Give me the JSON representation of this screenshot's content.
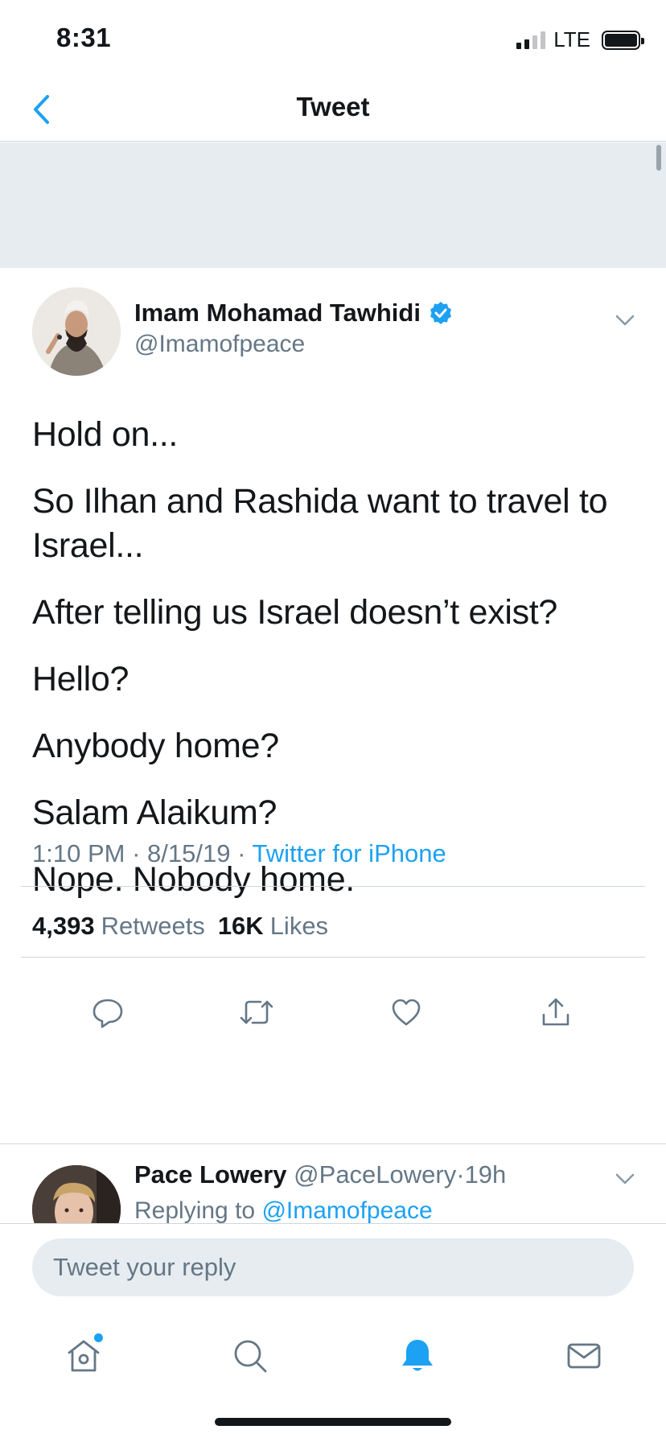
{
  "status_bar": {
    "time": "8:31",
    "network": "LTE"
  },
  "nav": {
    "title": "Tweet",
    "back_icon": "chevron-left-icon"
  },
  "tweet": {
    "author_name": "Imam Mohamad Tawhidi",
    "author_handle": "@Imamofpeace",
    "verified": true,
    "body": [
      "Hold on...",
      "So Ilhan and Rashida want to travel to Israel...",
      "After telling us Israel doesn’t exist?",
      "Hello?",
      "Anybody home?",
      "Salam Alaikum?",
      "Nope. Nobody home."
    ],
    "time": "1:10 PM",
    "date": "8/15/19",
    "separator": "·",
    "source": "Twitter for iPhone",
    "retweets_count": "4,393",
    "retweets_label": "Retweets",
    "likes_count": "16K",
    "likes_label": "Likes",
    "actions": [
      "reply-icon",
      "retweet-icon",
      "like-icon",
      "share-icon"
    ]
  },
  "reply": {
    "name": "Pace Lowery",
    "handle": "@PaceLowery",
    "time": "19h",
    "separator": "·",
    "replying_to_label": "Replying to",
    "replying_to_handle": "@Imamofpeace"
  },
  "compose": {
    "placeholder": "Tweet your reply"
  },
  "tab_bar": {
    "items": [
      "home-icon",
      "search-icon",
      "notifications-icon",
      "messages-icon"
    ],
    "active": "notifications-icon",
    "home_has_new": true
  },
  "colors": {
    "accent": "#1da1f2",
    "secondary_text": "#657786",
    "band": "#e6ecf0"
  }
}
